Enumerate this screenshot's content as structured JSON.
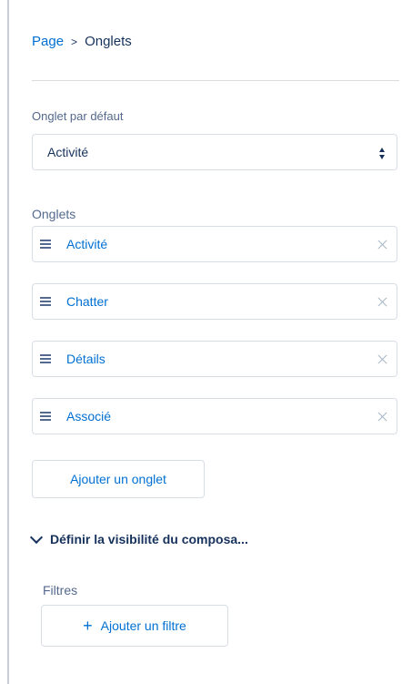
{
  "breadcrumb": {
    "parent": "Page",
    "separator": ">",
    "current": "Onglets"
  },
  "default_tab": {
    "label": "Onglet par défaut",
    "selected": "Activité"
  },
  "tabs_section": {
    "label": "Onglets",
    "items": [
      {
        "label": "Activité"
      },
      {
        "label": "Chatter"
      },
      {
        "label": "Détails"
      },
      {
        "label": "Associé"
      }
    ],
    "add_button_label": "Ajouter un onglet"
  },
  "visibility_section": {
    "title": "Définir la visibilité du composa...",
    "filters_label": "Filtres",
    "add_filter_label": "Ajouter un filtre"
  },
  "colors": {
    "link": "#0070d2",
    "text": "#16325c",
    "border": "#d8dde6"
  }
}
